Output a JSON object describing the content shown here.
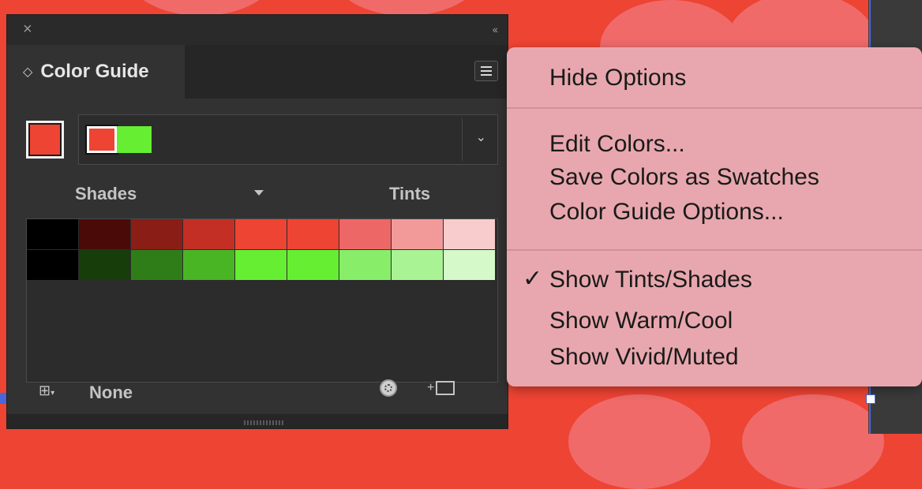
{
  "panel": {
    "close_icon": "×",
    "collapse_icon": "‹‹",
    "tab_arrows_icon": "◇",
    "title": "Color Guide",
    "menu_icon": "hamburger-icon",
    "current_color": "#ee4433",
    "harmony": {
      "base": "#ee4433",
      "colors": [
        "#66ee33"
      ]
    },
    "harmony_chevron": "⌄",
    "shades_label": "Shades",
    "tints_label": "Tints",
    "swatch_rows": [
      [
        "#000000",
        "#4a0b08",
        "#8b1d17",
        "#c32f25",
        "#ee4433",
        "#ee4433",
        "#ee6767",
        "#f29a9a",
        "#f8cccc"
      ],
      [
        "#000000",
        "#163d0a",
        "#2f7d19",
        "#49b524",
        "#66ee33",
        "#66ee33",
        "#88ee6a",
        "#aaf394",
        "#d5f9c9"
      ]
    ],
    "footer": {
      "grid_icon": "⊞",
      "grid_caret": "▾",
      "limit_label": "None",
      "save_icon": "+"
    }
  },
  "menu": {
    "items": [
      {
        "label": "Hide Options",
        "checked": false
      },
      {
        "label": "Edit Colors...",
        "checked": false
      },
      {
        "label": "Save Colors as Swatches",
        "checked": false
      },
      {
        "label": "Color Guide Options...",
        "checked": false
      },
      {
        "label": "Show Tints/Shades",
        "checked": true
      },
      {
        "label": "Show Warm/Cool",
        "checked": false
      },
      {
        "label": "Show Vivid/Muted",
        "checked": false
      }
    ],
    "check_mark": "✓"
  }
}
